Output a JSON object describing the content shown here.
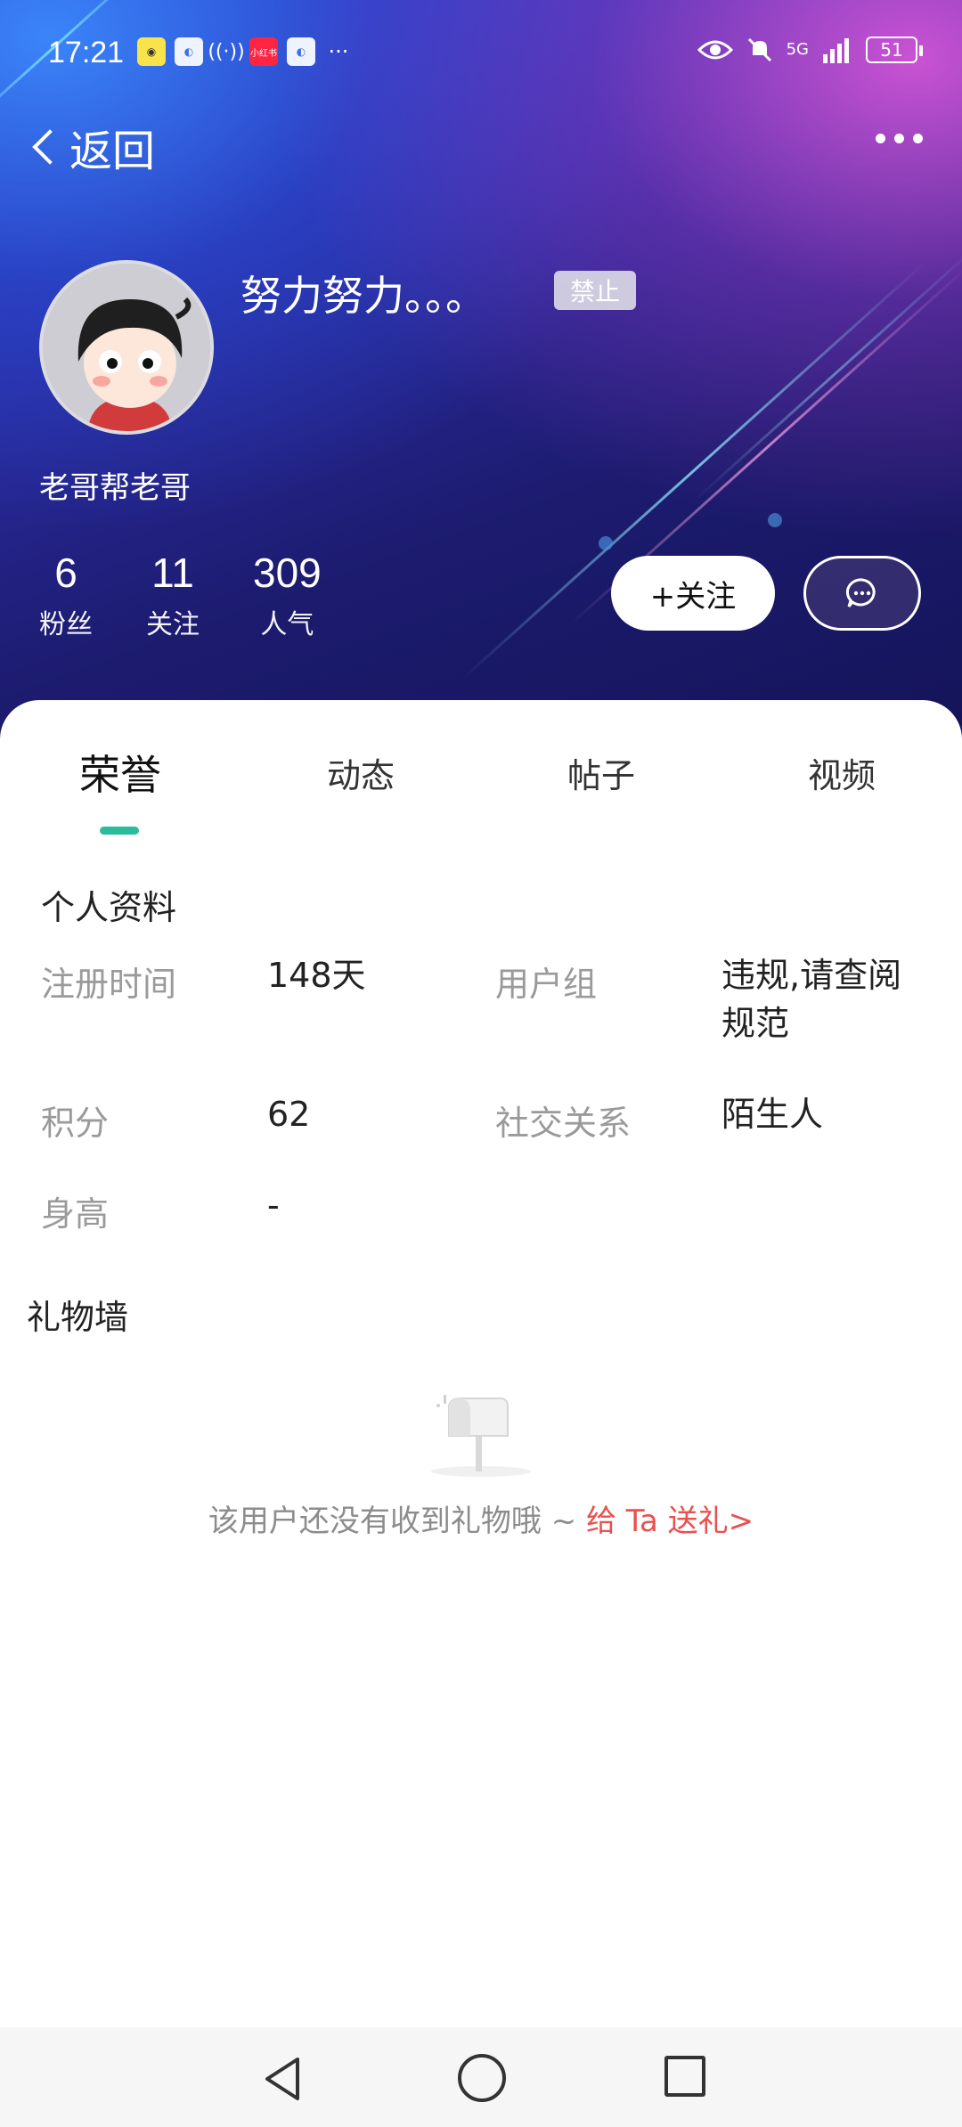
{
  "status_bar": {
    "time": "17:21",
    "network": "5G",
    "battery": "51"
  },
  "nav": {
    "back_label": "返回"
  },
  "profile": {
    "username": "努力努力。。。",
    "ban_badge": "禁止",
    "nickname": "老哥帮老哥",
    "stats": [
      {
        "value": "6",
        "label": "粉丝"
      },
      {
        "value": "11",
        "label": "关注"
      },
      {
        "value": "309",
        "label": "人气"
      }
    ],
    "follow_label": "+关注"
  },
  "tabs": [
    "荣誉",
    "动态",
    "帖子",
    "视频"
  ],
  "active_tab": "荣誉",
  "personal_info": {
    "title": "个人资料",
    "reg_time_label": "注册时间",
    "reg_time_value": "148天",
    "group_label": "用户组",
    "group_value_line1": "违规,请查阅",
    "group_value_line2": "规范",
    "points_label": "积分",
    "points_value": "62",
    "relation_label": "社交关系",
    "relation_value": "陌生人",
    "height_label": "身高",
    "height_value": "-"
  },
  "gift_wall": {
    "title": "礼物墙",
    "empty_text": "该用户还没有收到礼物哦 ~ ",
    "send_link": "给 Ta 送礼>"
  },
  "colors": {
    "accent": "#2bbd9b",
    "link_red": "#e9504f",
    "hero_dark": "#1c1b6e"
  }
}
